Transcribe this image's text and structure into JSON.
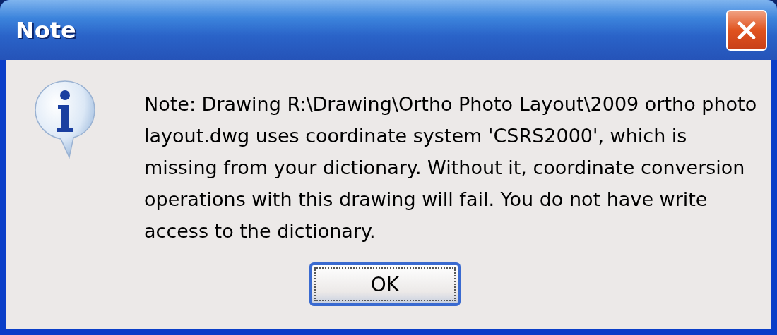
{
  "window": {
    "title": "Note"
  },
  "message": "Note:  Drawing R:\\Drawing\\Ortho Photo Layout\\2009 ortho photo layout.dwg uses coordinate system 'CSRS2000', which is missing from your dictionary.  Without it, coordinate conversion operations with this drawing will fail.  You do not have write access to the dictionary.",
  "buttons": [
    {
      "label": "OK",
      "selected": true
    }
  ]
}
